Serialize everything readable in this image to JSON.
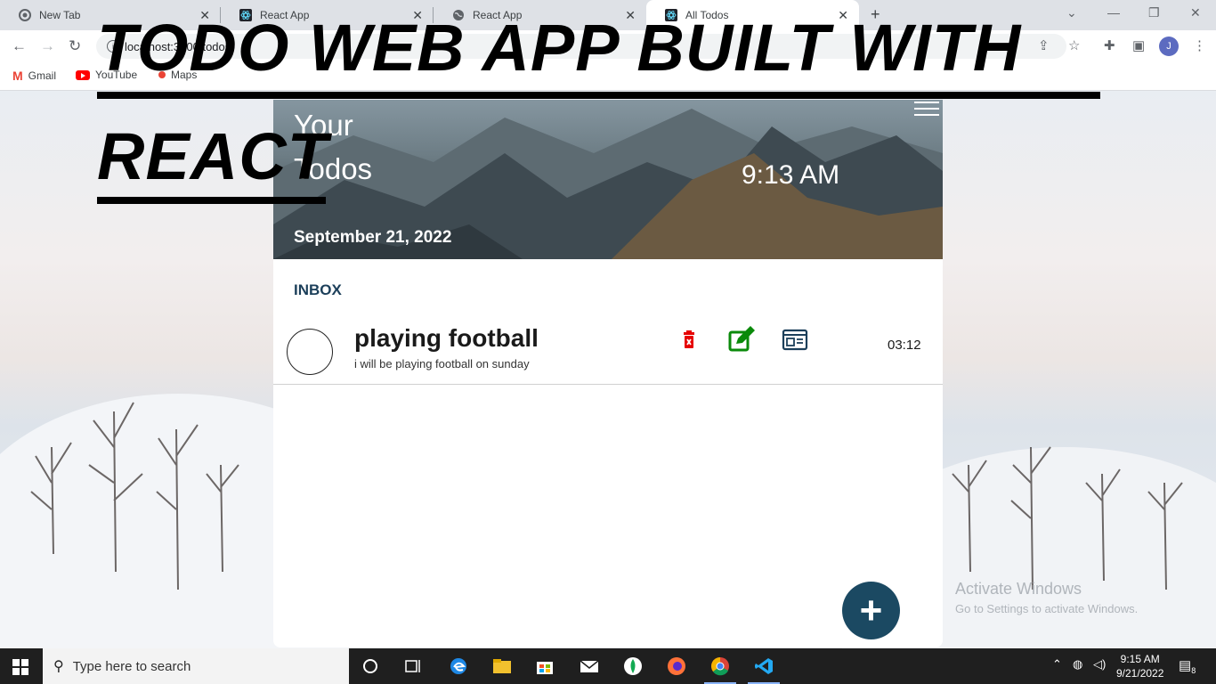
{
  "browser": {
    "tabs": [
      {
        "label": "New Tab",
        "icon": "chrome-icon"
      },
      {
        "label": "React App",
        "icon": "react-icon"
      },
      {
        "label": "React App",
        "icon": "globe-icon"
      },
      {
        "label": "All Todos",
        "icon": "react-icon"
      }
    ],
    "active_tab": 3,
    "address": "localhost:3000/todos",
    "bookmarks": [
      "Gmail",
      "YouTube",
      "Maps"
    ],
    "profile_initial": "J"
  },
  "banner": {
    "line1": "TODO WEB APP BUILT WITH",
    "line2": "REACT"
  },
  "app": {
    "hero": {
      "title": "Your Todos",
      "time": "9:13 AM",
      "date": "September 21, 2022"
    },
    "section_label": "INBOX",
    "todos": [
      {
        "title": "playing football",
        "description": "i will be playing football on sunday",
        "time": "03:12"
      }
    ],
    "add_button": "+"
  },
  "watermark": {
    "line1": "Activate Windows",
    "line2": "Go to Settings to activate Windows."
  },
  "taskbar": {
    "search_placeholder": "Type here to search",
    "time": "9:15 AM",
    "date": "9/21/2022",
    "notifications": "8"
  },
  "colors": {
    "accent": "#1b4962",
    "delete": "#e60000",
    "edit": "#0a8a0a",
    "details": "#1c3f5a"
  }
}
